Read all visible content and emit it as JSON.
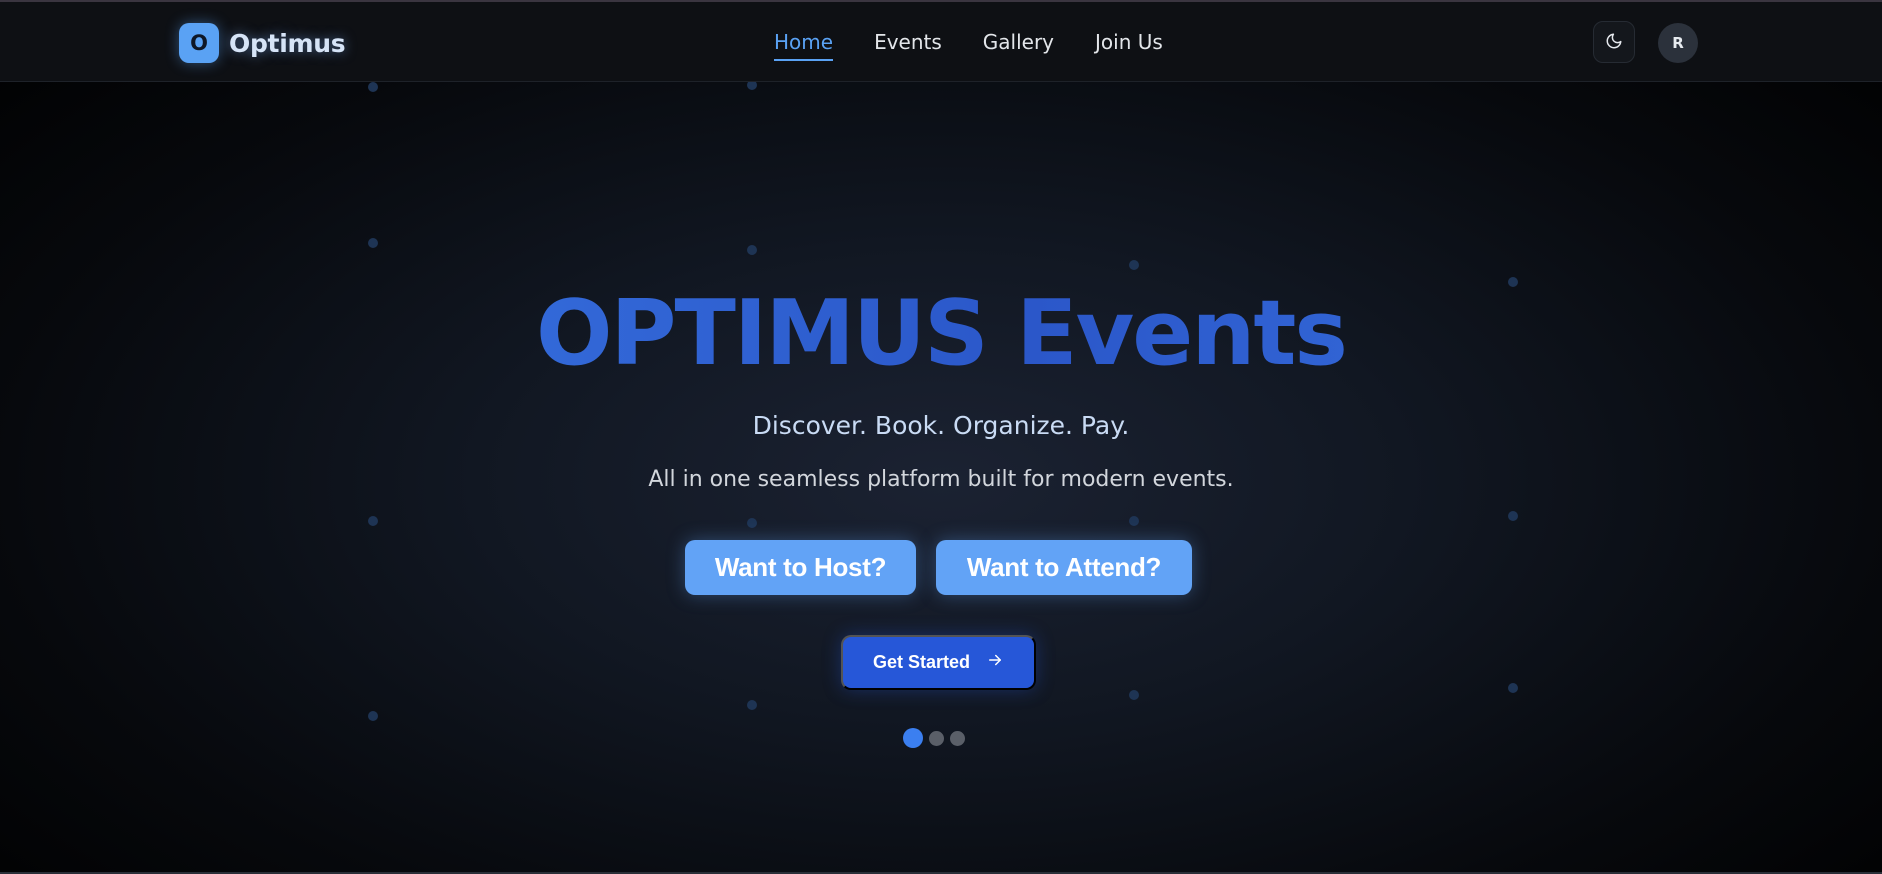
{
  "brand": {
    "logo_letter": "O",
    "name": "Optimus"
  },
  "nav": {
    "items": [
      {
        "label": "Home",
        "active": true
      },
      {
        "label": "Events",
        "active": false
      },
      {
        "label": "Gallery",
        "active": false
      },
      {
        "label": "Join Us",
        "active": false
      }
    ]
  },
  "header_actions": {
    "theme_toggle_icon": "moon-icon",
    "avatar_initial": "R"
  },
  "hero": {
    "title": "OPTIMUS Events",
    "tagline": "Discover. Book. Organize. Pay.",
    "description": "All in one seamless platform built for modern events.",
    "host_button": "Want to Host?",
    "attend_button": "Want to Attend?",
    "get_started_button": "Get Started",
    "get_started_icon": "arrow-right-icon"
  },
  "carousel": {
    "total": 3,
    "active_index": 0
  },
  "colors": {
    "accent": "#5aa2f4",
    "title_blue": "#3a6fe0",
    "primary_button": "#2657d8",
    "secondary_button": "#62a3f6",
    "background": "#111722"
  }
}
